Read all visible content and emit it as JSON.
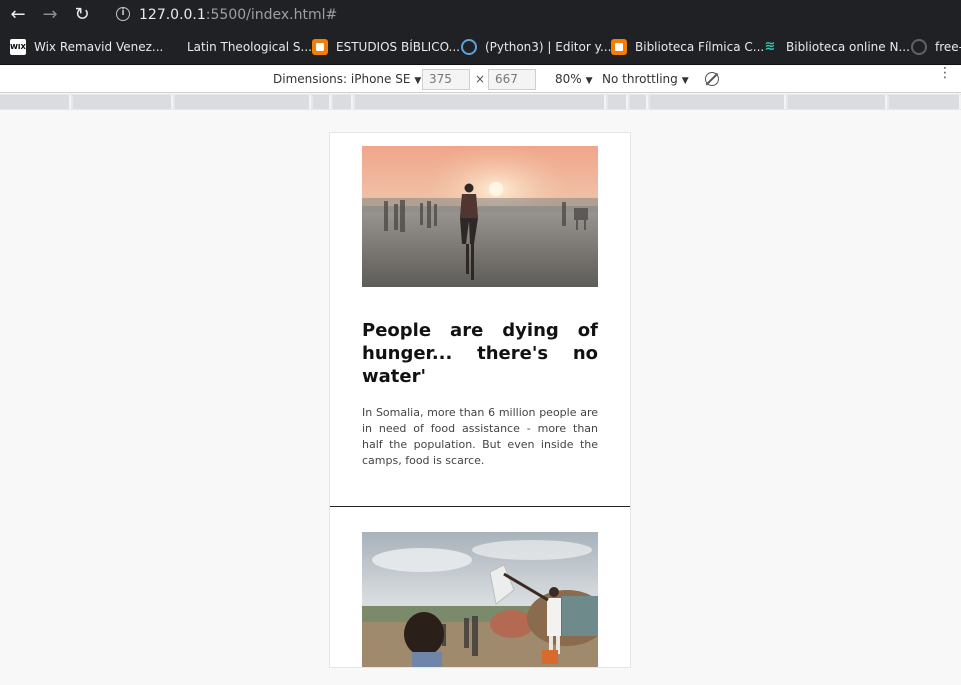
{
  "browser": {
    "url_host": "127.0.0.1",
    "url_rest": ":5500/index.html#",
    "info_icon": "i"
  },
  "bookmarks": [
    {
      "label": "Wix Remavid Venez...",
      "icon": "wix-icon",
      "icon_text": "WIX"
    },
    {
      "label": "Latin Theological S...",
      "icon": "blank-icon",
      "icon_text": ""
    },
    {
      "label": "ESTUDIOS BÍBLICO...",
      "icon": "blogger-icon",
      "icon_text": ""
    },
    {
      "label": "(Python3) | Editor y...",
      "icon": "python-icon",
      "icon_text": ""
    },
    {
      "label": "Biblioteca Fílmica C...",
      "icon": "blogger-icon",
      "icon_text": ""
    },
    {
      "label": "Biblioteca online N...",
      "icon": "layers-icon",
      "icon_text": "≋"
    },
    {
      "label": "free-",
      "icon": "github-icon",
      "icon_text": ""
    }
  ],
  "devtools": {
    "dimensions_label": "Dimensions: iPhone SE",
    "width_value": "375",
    "height_value": "667",
    "times": "×",
    "zoom": "80%",
    "throttling": "No throttling",
    "caret": "▼",
    "more": "⋮"
  },
  "articles": [
    {
      "headline": "People are dying of hunger... there's no water'",
      "summary": "In Somalia, more than 6 million people are in need of food assistance - more than half the population. But even inside the camps, food is scarce."
    },
    {
      "headline": "",
      "summary": ""
    }
  ],
  "colors": {
    "chrome_dark": "#202124",
    "page_bg": "#f8f8f8",
    "card_divider": "#222222",
    "blogger_orange": "#f57d00"
  }
}
